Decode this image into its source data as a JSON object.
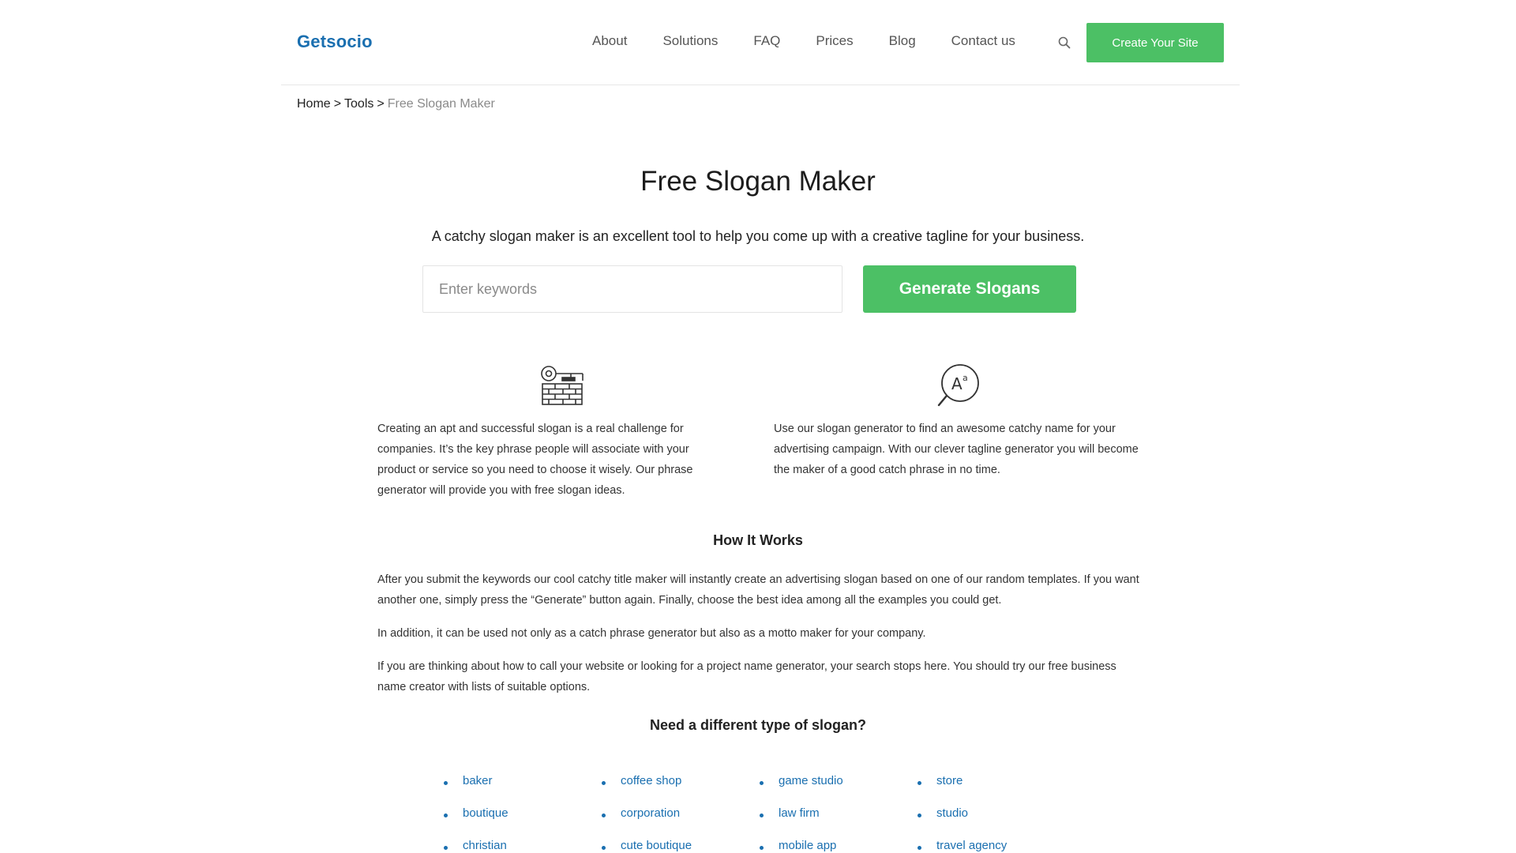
{
  "header": {
    "logo": "Getsocio",
    "nav": [
      "About",
      "Solutions",
      "FAQ",
      "Prices",
      "Blog",
      "Contact us"
    ],
    "cta_label": "Create Your Site",
    "search_icon": "search-icon"
  },
  "breadcrumb": {
    "home": "Home",
    "tools": "Tools",
    "separator": ">",
    "current": "Free Slogan Maker"
  },
  "hero": {
    "title": "Free Slogan Maker",
    "subtitle": "A catchy slogan maker is an excellent tool to help you come up with a creative tagline for your business.",
    "input_placeholder": "Enter keywords",
    "input_value": "",
    "button_label": "Generate Slogans"
  },
  "features": [
    {
      "icon": "key-bricks-icon",
      "text": "Creating an apt and successful slogan is a real challenge for companies. It’s the key phrase people will associate with your product or service so you need to choose it wisely. Our phrase generator will provide you with free slogan ideas."
    },
    {
      "icon": "text-magnifier-icon",
      "text": "Use our slogan generator to find an awesome catchy name for your advertising campaign. With our clever tagline generator you will become the maker of a good catch phrase in no time."
    }
  ],
  "how_it_works": {
    "title": "How It Works",
    "paragraphs": [
      "After you submit the keywords our cool catchy title maker will instantly create an advertising slogan based on one of our random templates. If you want another one, simply press the “Generate” button again. Finally, choose the best idea among all the examples you could get.",
      "In addition, it can be used not only as a catch phrase generator but also as a motto maker for your company.",
      "If you are thinking about how to call your website or looking for a project name generator, your search stops here. You should try our free business name creator with lists of suitable options."
    ]
  },
  "slogan_types": {
    "title": "Need a different type of slogan?",
    "columns": [
      [
        "baker",
        "boutique",
        "christian"
      ],
      [
        "coffee shop",
        "corporation",
        "cute boutique"
      ],
      [
        "game studio",
        "law firm",
        "mobile app"
      ],
      [
        "store",
        "studio",
        "travel agency"
      ]
    ]
  },
  "colors": {
    "brand_blue": "#1a6fb0",
    "accent_green": "#4cc065"
  }
}
